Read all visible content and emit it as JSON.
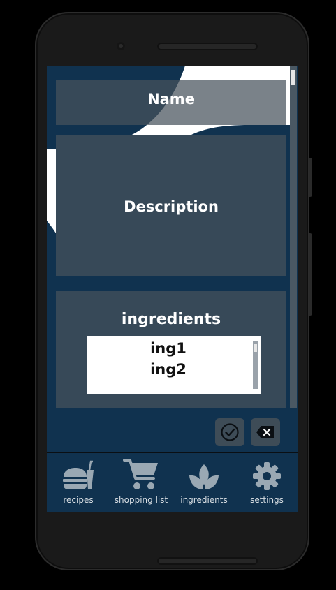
{
  "form": {
    "name_label": "Name",
    "description_label": "Description",
    "ingredients_label": "ingredients",
    "ingredients": [
      "ing1",
      "ing2"
    ]
  },
  "actions": {
    "confirm_icon": "check-circle-icon",
    "clear_icon": "backspace-icon"
  },
  "nav": {
    "items": [
      {
        "label": "recipes",
        "icon": "food-icon"
      },
      {
        "label": "shopping list",
        "icon": "cart-icon"
      },
      {
        "label": "ingredients",
        "icon": "leaf-icon"
      },
      {
        "label": "settings",
        "icon": "gear-icon"
      }
    ]
  },
  "colors": {
    "background": "#10324f",
    "panel": "#46525c",
    "icon": "#9aa8b3",
    "text": "#ffffff"
  }
}
